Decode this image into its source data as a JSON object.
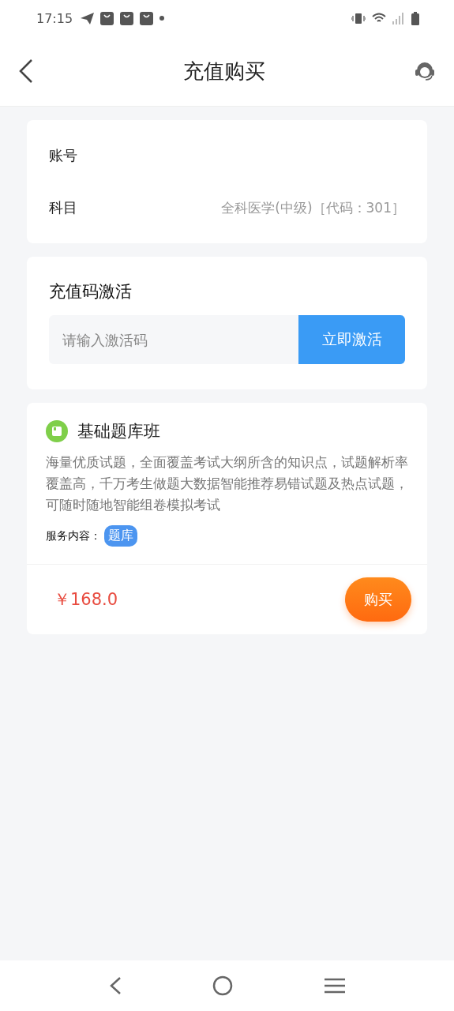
{
  "status_bar": {
    "time": "17:15"
  },
  "header": {
    "title": "充值购买"
  },
  "account": {
    "rows": [
      {
        "label": "账号"
      },
      {
        "label": "科目",
        "value": "全科医学(中级)［代码：301］"
      }
    ]
  },
  "activation": {
    "title": "充值码激活",
    "placeholder": "请输入激活码",
    "button": "立即激活"
  },
  "product": {
    "title": "基础题库班",
    "description": "海量优质试题，全面覆盖考试大纲所含的知识点，试题解析率覆盖高，千万考生做题大数据智能推荐易错试题及热点试题，可随时随地智能组卷模拟考试",
    "service_label": "服务内容：",
    "service_tags": [
      "题库"
    ],
    "price": "￥168.0",
    "buy_button": "购买"
  }
}
